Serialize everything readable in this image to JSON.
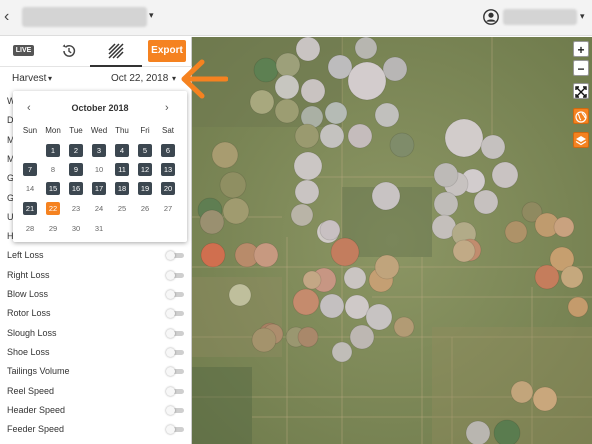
{
  "topbar": {
    "back_glyph": "‹",
    "chevron": "▾"
  },
  "toolbar": {
    "live_label": "LIVE",
    "export_label": "Export"
  },
  "selectors": {
    "harvest": "Harvest",
    "date": "Oct 22, 2018",
    "chevron": "▾"
  },
  "calendar": {
    "month": "October 2018",
    "prev": "‹",
    "next": "›",
    "weekdays": [
      "Sun",
      "Mon",
      "Tue",
      "Wed",
      "Thu",
      "Fri",
      "Sat"
    ],
    "weeks": [
      [
        "",
        "1",
        "2",
        "3",
        "4",
        "5",
        "6"
      ],
      [
        "7",
        "8",
        "9",
        "10",
        "11",
        "12",
        "13"
      ],
      [
        "14",
        "15",
        "16",
        "17",
        "18",
        "19",
        "20"
      ],
      [
        "21",
        "22",
        "23",
        "24",
        "25",
        "26",
        "27"
      ],
      [
        "28",
        "29",
        "30",
        "31",
        "",
        "",
        ""
      ]
    ],
    "data_days": [
      "1",
      "2",
      "3",
      "4",
      "5",
      "6",
      "7",
      "9",
      "11",
      "12",
      "13",
      "15",
      "16",
      "17",
      "18",
      "19",
      "20",
      "21"
    ],
    "selected_day": "22"
  },
  "layers": {
    "partial_items": [
      "W",
      "D",
      "M",
      "M",
      "G",
      "G",
      "U",
      "Header Height"
    ],
    "items": [
      "Left Loss",
      "Right Loss",
      "Blow Loss",
      "Rotor Loss",
      "Slough Loss",
      "Shoe Loss",
      "Tailings Volume",
      "Reel Speed",
      "Header Speed",
      "Feeder Speed"
    ]
  },
  "map_controls": {
    "zoom_in": "+",
    "zoom_out": "−"
  },
  "colors": {
    "accent": "#f58220",
    "dark_day": "#3c4750"
  },
  "icons": [
    "back-icon",
    "user-icon",
    "history-icon",
    "layers-icon",
    "fullscreen-icon",
    "globe-icon",
    "stack-icon",
    "arrow-icon"
  ]
}
